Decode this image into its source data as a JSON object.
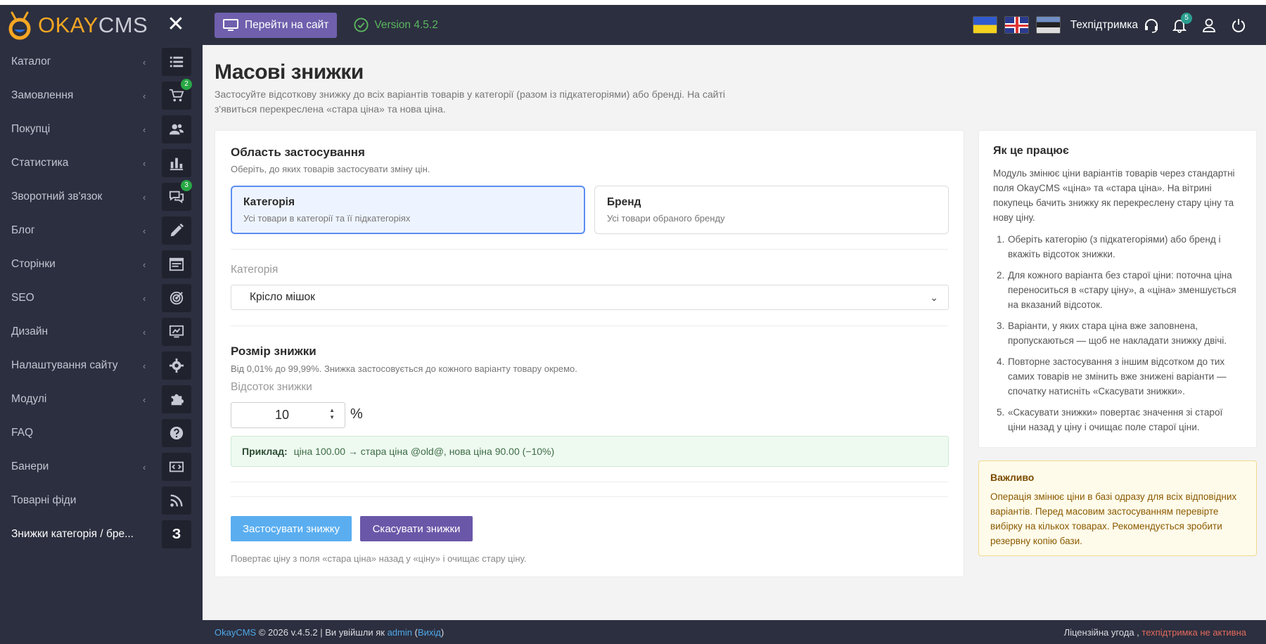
{
  "app": {
    "logo_okay": "OKAY",
    "logo_cms": "CMS"
  },
  "sidebar": {
    "items": [
      {
        "label": "Каталог",
        "icon": "list-icon",
        "arrow": true
      },
      {
        "label": "Замовлення",
        "icon": "cart-icon",
        "arrow": true,
        "badge": "2"
      },
      {
        "label": "Покупці",
        "icon": "users-icon",
        "arrow": true
      },
      {
        "label": "Статистика",
        "icon": "bar-chart-icon",
        "arrow": true
      },
      {
        "label": "Зворотний зв'язок",
        "icon": "comments-icon",
        "arrow": true,
        "badge": "3"
      },
      {
        "label": "Блог",
        "icon": "pencil-icon",
        "arrow": true
      },
      {
        "label": "Сторінки",
        "icon": "page-icon",
        "arrow": true
      },
      {
        "label": "SEO",
        "icon": "target-icon",
        "arrow": true
      },
      {
        "label": "Дизайн",
        "icon": "monitor-icon",
        "arrow": true
      },
      {
        "label": "Налаштування сайту",
        "icon": "gear-icon",
        "arrow": true
      },
      {
        "label": "Модулі",
        "icon": "puzzle-icon",
        "arrow": true
      },
      {
        "label": "FAQ",
        "icon": "question-icon",
        "arrow": false
      },
      {
        "label": "Банери",
        "icon": "banner-icon",
        "arrow": true
      },
      {
        "label": "Товарні фіди",
        "icon": "rss-icon",
        "arrow": false
      },
      {
        "label": "Знижки категорія / бре...",
        "icon": "z-letter-icon",
        "arrow": false,
        "active": true,
        "letter": "З"
      }
    ]
  },
  "topbar": {
    "goto_site": "Перейти на сайт",
    "version": "Version 4.5.2",
    "support": "Техпідтримка",
    "notifications_count": "5"
  },
  "page": {
    "title": "Масові знижки",
    "description": "Застосуйте відсоткову знижку до всіх варіантів товарів у категорії (разом із підкатегоріями) або бренді. На сайті з'явиться перекреслена «стара ціна» та нова ціна."
  },
  "scope": {
    "title": "Область застосування",
    "subtitle": "Оберіть, до яких товарів застосувати зміну цін.",
    "options": [
      {
        "title": "Категорія",
        "desc": "Усі товари в категорії та її підкатегоріях",
        "selected": true
      },
      {
        "title": "Бренд",
        "desc": "Усі товари обраного бренду",
        "selected": false
      }
    ]
  },
  "category": {
    "label": "Категорія",
    "selected": "Крісло мішок"
  },
  "discount": {
    "title": "Розмір знижки",
    "subtitle": "Від 0,01% до 99,99%. Знижка застосовується до кожного варіанту товару окремо.",
    "label": "Відсоток знижки",
    "value": "10",
    "unit": "%",
    "example_label": "Приклад:",
    "example_text": "ціна 100.00 → стара ціна @old@, нова ціна 90.00 (−10%)"
  },
  "actions": {
    "apply": "Застосувати знижку",
    "cancel": "Скасувати знижки",
    "hint": "Повертає ціну з поля «стара ціна» назад у «ціну» і очищає стару ціну."
  },
  "how": {
    "title": "Як це працює",
    "intro": "Модуль змінює ціни варіантів товарів через стандартні поля OkayCMS «ціна» та «стара ціна». На вітрині покупець бачить знижку як перекреслену стару ціну та нову ціну.",
    "steps": [
      "Оберіть категорію (з підкатегоріями) або бренд і вкажіть відсоток знижки.",
      "Для кожного варіанта без старої ціни: поточна ціна переноситься в «стару ціну», а «ціна» зменшується на вказаний відсоток.",
      "Варіанти, у яких стара ціна вже заповнена, пропускаються — щоб не накладати знижку двічі.",
      "Повторне застосування з іншим відсотком до тих самих товарів не змінить вже знижені варіанти — спочатку натисніть «Скасувати знижки».",
      "«Скасувати знижки» повертає значення зі старої ціни назад у ціну і очищає поле старої ціни."
    ]
  },
  "warning": {
    "title": "Важливо",
    "text": "Операція змінює ціни в базі одразу для всіх відповідних варіантів. Перед масовим застосуванням перевірте вибірку на кількох товарах. Рекомендується зробити резервну копію бази."
  },
  "footer": {
    "brand": "OkayCMS",
    "copyright": " © 2026 v.4.5.2 | Ви увійшли як ",
    "user": "admin",
    "open_paren": " (",
    "logout": "Вихід",
    "close_paren": ")",
    "license": "Ліцензійна угода ,",
    "support_status": "техпідтримка не активна"
  },
  "colors": {
    "sidebar_bg": "#2c2f3f",
    "accent_purple": "#6f5fad",
    "apply_blue": "#5aaef0",
    "version_green": "#5bb65f"
  }
}
